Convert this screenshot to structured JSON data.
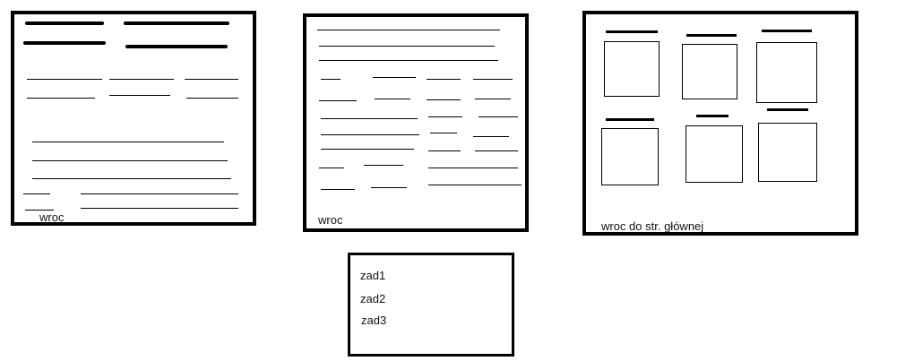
{
  "screen_a": {
    "back_label": "wroc"
  },
  "screen_b": {
    "back_label": "wroc"
  },
  "screen_c": {
    "back_label": "wroc do str. głównej"
  },
  "menu": {
    "items": [
      "zad1",
      "zad2",
      "zad3"
    ]
  }
}
